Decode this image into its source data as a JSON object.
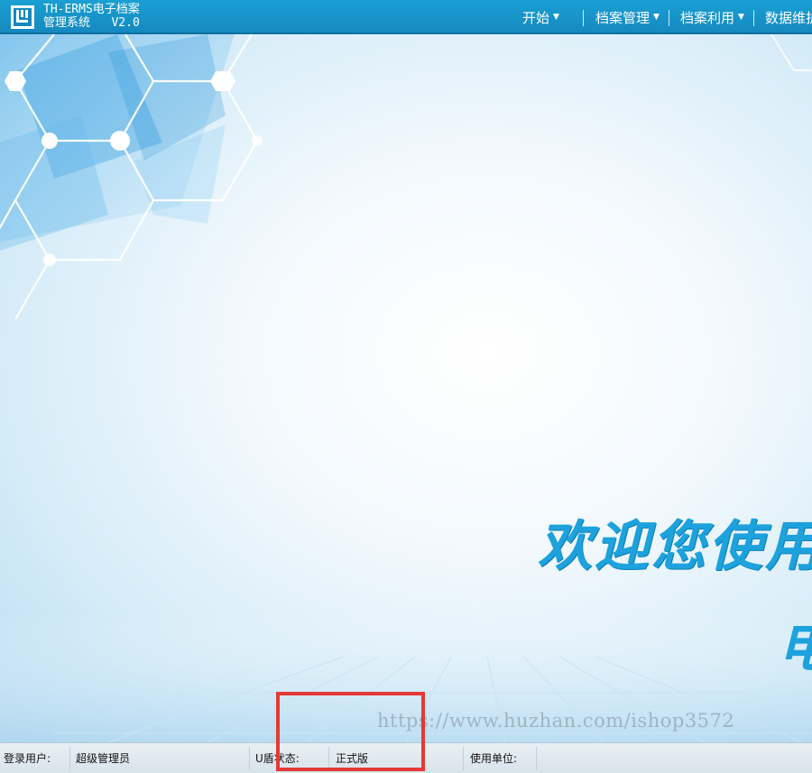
{
  "header": {
    "logo_icon": "archive-logo-icon",
    "title_line1": "TH-ERMS电子档案",
    "title_line2": "管理系统   V2.0",
    "menu": [
      {
        "label": "开始",
        "has_caret": true
      },
      {
        "label": "档案管理",
        "has_caret": true
      },
      {
        "label": "档案利用",
        "has_caret": true
      },
      {
        "label": "数据维护",
        "has_caret": false
      }
    ]
  },
  "main": {
    "welcome_text": "欢迎您使用",
    "welcome_text_2": "电",
    "watermark": "https://www.huzhan.com/ishop3572"
  },
  "statusbar": {
    "login_user_label": "登录用户:",
    "login_user_value": "超级管理员",
    "ukey_label": "U盾状态:",
    "ukey_value": "正式版",
    "unit_label": "使用单位:",
    "unit_value": ""
  },
  "colors": {
    "header_bg": "#1589c0",
    "welcome": "#1da2dd",
    "highlight_border": "#e53935"
  }
}
